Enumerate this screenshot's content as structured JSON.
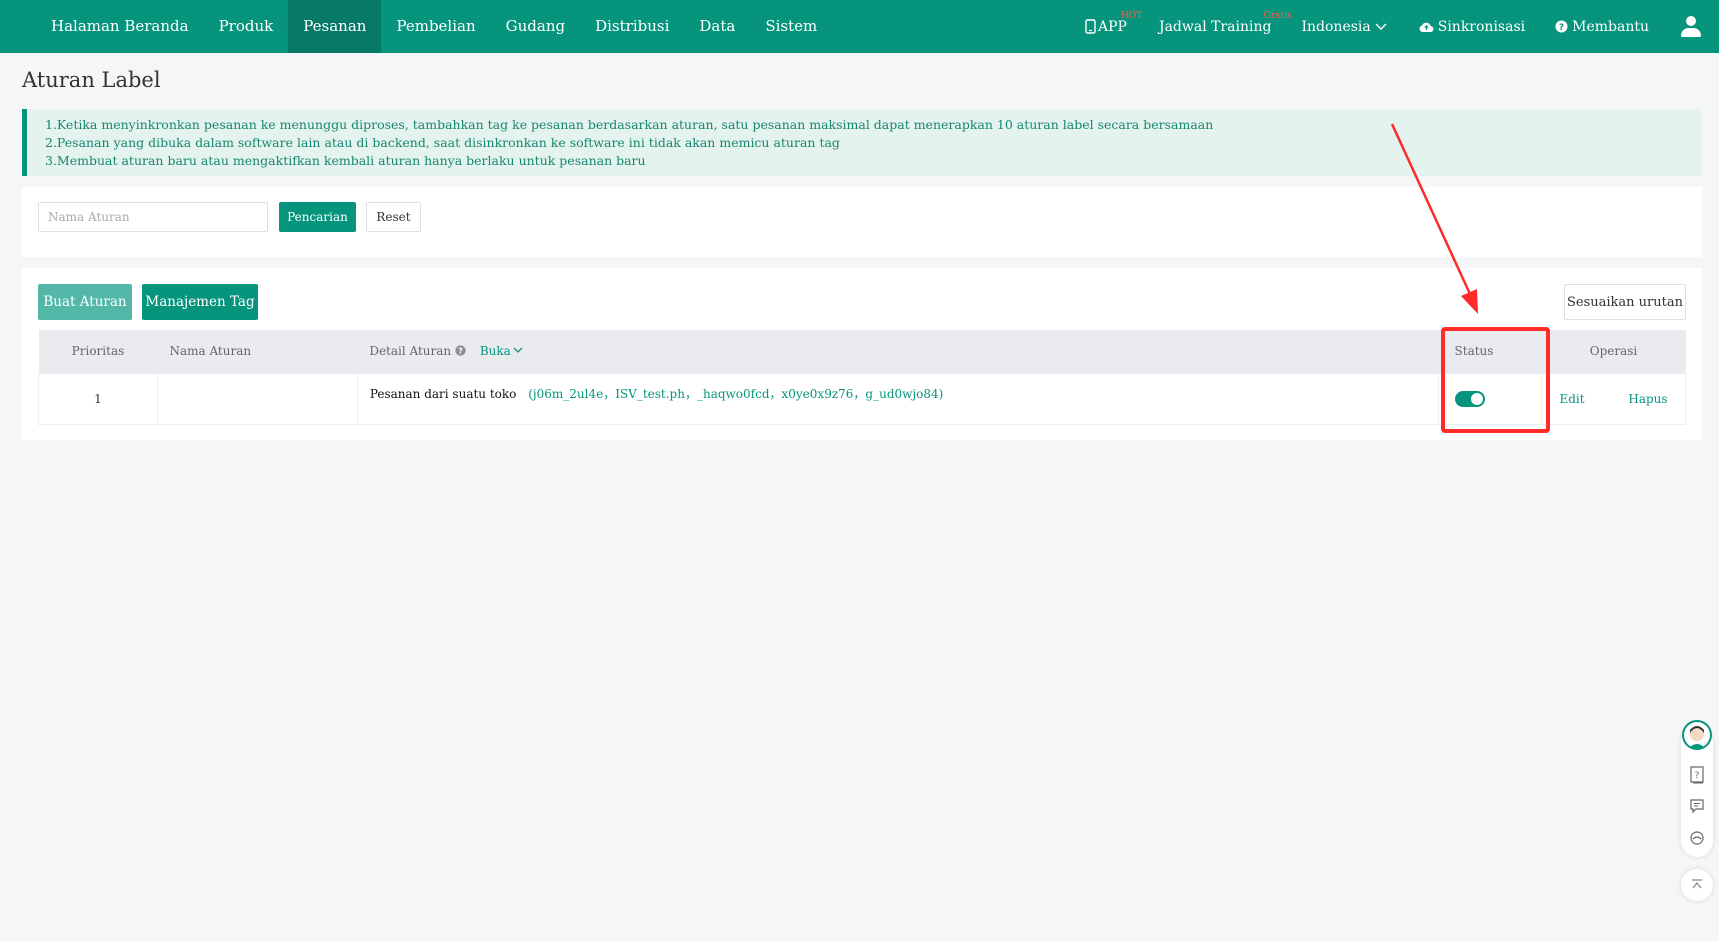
{
  "header": {
    "nav": [
      "Halaman Beranda",
      "Produk",
      "Pesanan",
      "Pembelian",
      "Gudang",
      "Distribusi",
      "Data",
      "Sistem"
    ],
    "active_nav": "Pesanan",
    "app_label": "APP",
    "app_badge": "HOT",
    "training_label": "Jadwal Training",
    "training_badge": "Gratis",
    "language": "Indonesia",
    "sync_label": "Sinkronisasi",
    "help_label": "Membantu"
  },
  "page": {
    "title": "Aturan Label"
  },
  "notice": {
    "lines": [
      "1.Ketika menyinkronkan pesanan ke menunggu diproses, tambahkan tag ke pesanan berdasarkan aturan, satu pesanan maksimal dapat menerapkan 10 aturan label secara bersamaan",
      "2.Pesanan yang dibuka dalam software lain atau di backend, saat disinkronkan ke software ini tidak akan memicu aturan tag",
      "3.Membuat aturan baru atau mengaktifkan kembali aturan hanya berlaku untuk pesanan baru"
    ]
  },
  "search": {
    "placeholder": "Nama Aturan",
    "value": "",
    "search_label": "Pencarian",
    "reset_label": "Reset"
  },
  "toolbar": {
    "create_label": "Buat Aturan",
    "tag_mgmt_label": "Manajemen Tag",
    "sort_label": "Sesuaikan urutan"
  },
  "table": {
    "headers": {
      "priority": "Prioritas",
      "name": "Nama Aturan",
      "detail": "Detail Aturan",
      "expand": "Buka",
      "status": "Status",
      "operation": "Operasi"
    },
    "rows": [
      {
        "priority": "1",
        "name": "",
        "detail_label": "Pesanan dari suatu toko",
        "detail_value": "(j06m_2ul4e，ISV_test.ph，_haqwo0fcd，x0ye0x9z76，g_ud0wjo84)",
        "status_on": true,
        "edit_label": "Edit",
        "delete_label": "Hapus"
      }
    ]
  },
  "colors": {
    "brand": "#07947c",
    "annotation": "#ff2a2a"
  }
}
